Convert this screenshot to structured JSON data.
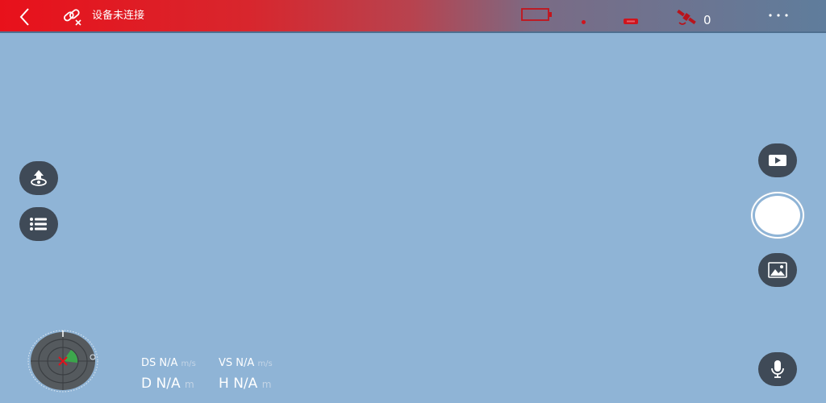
{
  "topbar": {
    "connection_status": "设备未连接",
    "satellite_count": "0"
  },
  "icons": {
    "back": "chevron-left-icon",
    "link": "link-broken-icon",
    "battery": "battery-icon",
    "signal": "signal-icon",
    "remote": "remote-controller-icon",
    "satellite": "satellite-icon",
    "more": "more-icon",
    "takeoff": "takeoff-icon",
    "list": "list-icon",
    "video": "video-mode-icon",
    "gallery": "gallery-icon",
    "mic": "microphone-icon"
  },
  "telemetry": {
    "ds_label": "DS",
    "ds_value": "N/A",
    "ds_unit": "m/s",
    "vs_label": "VS",
    "vs_value": "N/A",
    "vs_unit": "m/s",
    "d_label": "D",
    "d_value": "N/A",
    "d_unit": "m",
    "h_label": "H",
    "h_value": "N/A",
    "h_unit": "m"
  },
  "colors": {
    "topbar_left": "#e8111b",
    "topbar_right": "#5f7d9c",
    "background": "#8fb4d6",
    "button": "#3f4a57",
    "alert": "#d0141d"
  }
}
